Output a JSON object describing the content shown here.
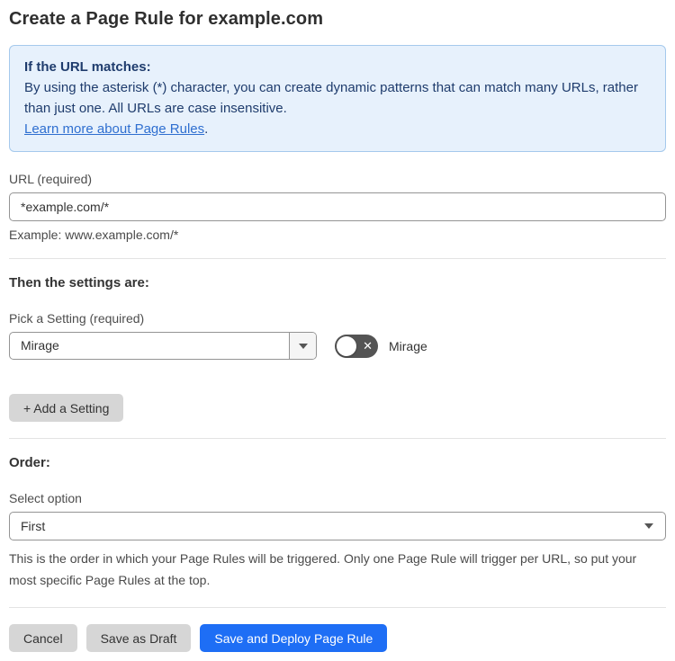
{
  "page": {
    "title": "Create a Page Rule for example.com"
  },
  "info_box": {
    "heading": "If the URL matches:",
    "body": "By using the asterisk (*) character, you can create dynamic patterns that can match many URLs, rather than just one. All URLs are case insensitive.",
    "link_label": "Learn more about Page Rules",
    "link_suffix": "."
  },
  "url_section": {
    "label": "URL (required)",
    "value": "*example.com/*",
    "example": "Example: www.example.com/*"
  },
  "settings_section": {
    "heading": "Then the settings are:",
    "picker_label": "Pick a Setting (required)",
    "picker_value": "Mirage",
    "toggle_label": "Mirage",
    "toggle_state": "off",
    "add_setting_label": "+ Add a Setting"
  },
  "order_section": {
    "heading": "Order:",
    "select_label": "Select option",
    "select_value": "First",
    "help_text": "This is the order in which your Page Rules will be triggered. Only one Page Rule will trigger per URL, so put your most specific Page Rules at the top."
  },
  "footer": {
    "cancel_label": "Cancel",
    "save_draft_label": "Save as Draft",
    "save_deploy_label": "Save and Deploy Page Rule"
  },
  "colors": {
    "info_bg": "#e7f1fc",
    "info_border": "#a5c9ec",
    "info_text": "#1f3c6d",
    "link": "#2f6fd0",
    "primary_button": "#1e6ef5",
    "gray_button": "#d6d6d6",
    "toggle_off": "#545454"
  }
}
